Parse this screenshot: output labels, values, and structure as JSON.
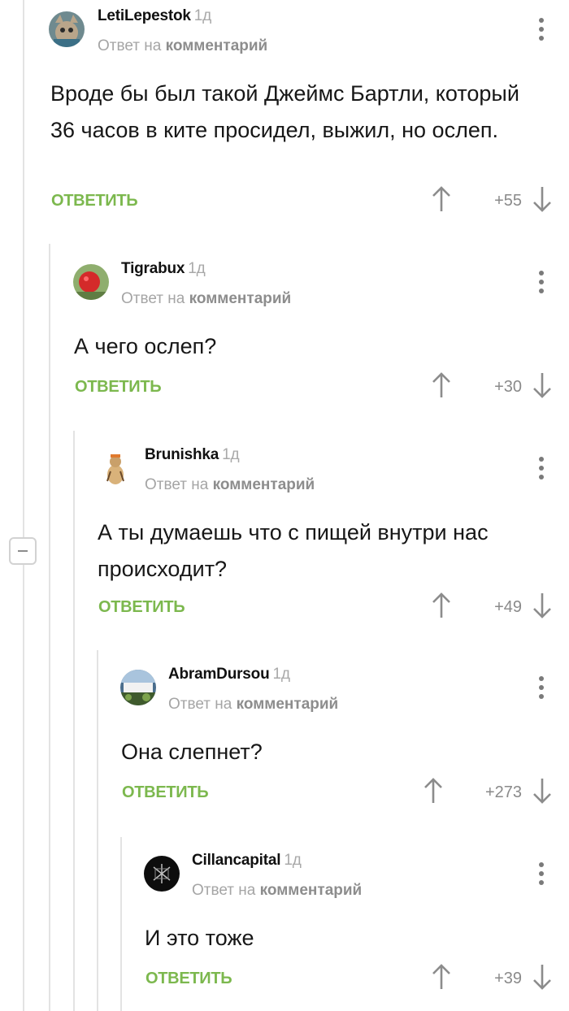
{
  "comments": [
    {
      "username": "LetiLepestok",
      "time": "1д",
      "reply_prefix": "Ответ на",
      "reply_target": "комментарий",
      "text": "Вроде бы был такой Джеймс Бартли, который 36 часов в ките просидел, выжил, но ослеп.",
      "reply_label": "ОТВЕТИТЬ",
      "score": "+55"
    },
    {
      "username": "Tigrabux",
      "time": "1д",
      "reply_prefix": "Ответ на",
      "reply_target": "комментарий",
      "text": "А чего ослеп?",
      "reply_label": "ОТВЕТИТЬ",
      "score": "+30"
    },
    {
      "username": "Brunishka",
      "time": "1д",
      "reply_prefix": "Ответ на",
      "reply_target": "комментарий",
      "text": "А ты думаешь что с пищей внутри нас происходит?",
      "reply_label": "ОТВЕТИТЬ",
      "score": "+49"
    },
    {
      "username": "AbramDursou",
      "time": "1д",
      "reply_prefix": "Ответ на",
      "reply_target": "комментарий",
      "text": "Она слепнет?",
      "reply_label": "ОТВЕТИТЬ",
      "score": "+273"
    },
    {
      "username": "Cillancapital",
      "time": "1д",
      "reply_prefix": "Ответ на",
      "reply_target": "комментарий",
      "text": "И это тоже",
      "reply_label": "ОТВЕТИТЬ",
      "score": "+39"
    }
  ],
  "colors": {
    "reply": "#7cb84e",
    "thread_line": "#e3e3e3",
    "muted": "#a5a5a5"
  },
  "icons": [
    "upvote-arrow-icon",
    "downvote-arrow-icon",
    "more-vertical-icon",
    "collapse-minus-icon"
  ]
}
